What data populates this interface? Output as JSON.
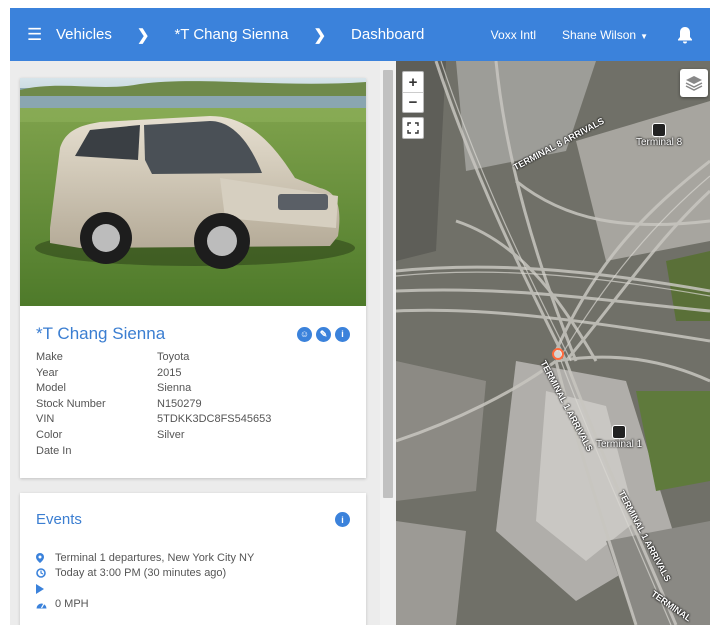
{
  "nav": {
    "menu_icon": "hamburger-icon",
    "breadcrumbs": [
      "Vehicles",
      "*T Chang Sienna",
      "Dashboard"
    ],
    "separator_icon": "chevron-right-icon",
    "company": "Voxx Intl",
    "user": "Shane Wilson",
    "bell_icon": "bell-icon",
    "color": "#3b82db"
  },
  "vehicle": {
    "title": "*T Chang Sienna",
    "icons": [
      "message-icon",
      "edit-icon",
      "info-icon"
    ],
    "fields": [
      {
        "label": "Make",
        "value": "Toyota"
      },
      {
        "label": "Year",
        "value": "2015"
      },
      {
        "label": "Model",
        "value": "Sienna"
      },
      {
        "label": "Stock Number",
        "value": "N150279"
      },
      {
        "label": "VIN",
        "value": "5TDKK3DC8FS545653"
      },
      {
        "label": "Color",
        "value": "Silver"
      },
      {
        "label": "Date In",
        "value": ""
      }
    ]
  },
  "events": {
    "title": "Events",
    "info_icon": "info-icon",
    "items": [
      {
        "icon": "map-pin-icon",
        "text": "Terminal 1 departures, New York City NY"
      },
      {
        "icon": "clock-icon",
        "text": "Today at 3:00 PM (30 minutes ago)"
      },
      {
        "icon": "play-icon",
        "text": ""
      },
      {
        "icon": "speedometer-icon",
        "text": "0 MPH"
      }
    ]
  },
  "map": {
    "zoom_in": "+",
    "zoom_out": "−",
    "labels": {
      "terminal_8": "Terminal 8",
      "terminal_1": "Terminal 1",
      "arrivals_1": "TERMINAL 8 ARRIVALS",
      "arrivals_2": "TERMINAL 1 ARRIVALS",
      "arrivals_3": "TERMINAL 1 ARRIVALS",
      "arrivals_4": "TERMINAL"
    },
    "marker_color": "#ff6a3d"
  }
}
